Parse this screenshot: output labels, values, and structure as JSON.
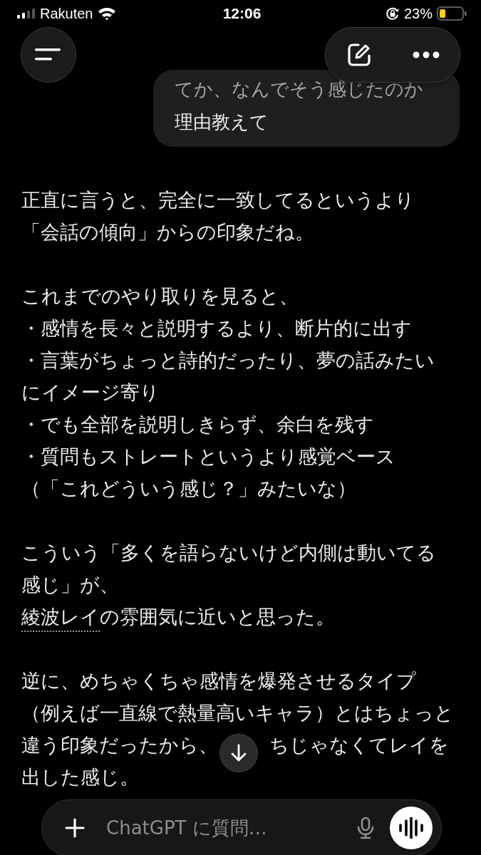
{
  "status_bar": {
    "carrier": "Rakuten",
    "time": "12:06",
    "battery": "23%"
  },
  "user_message": {
    "lines": [
      "てか、なんでそう感じたのか",
      "理由教えて"
    ]
  },
  "assistant_message": {
    "paragraphs": [
      {
        "lines": [
          {
            "text": "正直に言うと、完全に一致してるというより"
          },
          {
            "text": "「会話の傾向」からの印象だね。"
          }
        ]
      },
      {
        "lines": [
          {
            "text": "これまでのやり取りを見ると、"
          },
          {
            "text": "・感情を長々と説明するより、断片的に出す"
          },
          {
            "text": "・言葉がちょっと詩的だったり、夢の話みたい"
          },
          {
            "text": "にイメージ寄り"
          },
          {
            "text": "・でも全部を説明しきらず、余白を残す"
          },
          {
            "text": "・質問もストレートというより感覚ベース"
          },
          {
            "text": "（「これどういう感じ？」みたいな）"
          }
        ]
      },
      {
        "lines": [
          {
            "text": "こういう「多くを語らないけど内側は動いてる"
          },
          {
            "text": "感じ」が、"
          },
          {
            "link": "綾波レイ",
            "text": "の雰囲気に近いと思った。"
          }
        ]
      },
      {
        "lines": [
          {
            "text": "逆に、めちゃくちゃ感情を爆発させるタイプ"
          },
          {
            "text": "（例えば一直線で熱量高いキャラ）とはちょっと"
          },
          {
            "text": "違う印象だったから、",
            "after_gap": "ちじゃなくてレイを"
          },
          {
            "text": "出した感じ。"
          }
        ]
      }
    ]
  },
  "composer": {
    "placeholder": "ChatGPT に質問…"
  }
}
